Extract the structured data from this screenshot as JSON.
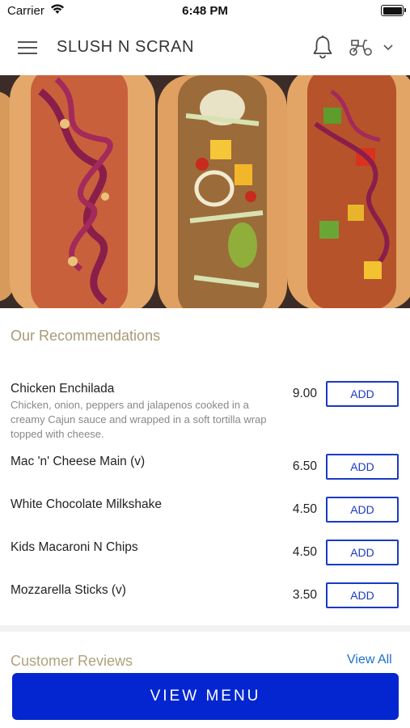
{
  "status_bar": {
    "carrier": "Carrier",
    "time": "6:48 PM"
  },
  "header": {
    "title": "SLUSH N SCRAN"
  },
  "icons": {
    "menu": "hamburger-menu-icon",
    "bell": "bell-icon",
    "delivery": "scooter-icon",
    "chevron": "chevron-down-icon"
  },
  "recommendations": {
    "title": "Our Recommendations",
    "items": [
      {
        "name": "Chicken Enchilada",
        "description": "Chicken, onion, peppers and jalapenos cooked in a creamy Cajun sauce and wrapped in a soft tortilla wrap topped with cheese.",
        "price": "9.00",
        "add_label": "ADD"
      },
      {
        "name": "Mac 'n' Cheese Main (v)",
        "description": "",
        "price": "6.50",
        "add_label": "ADD"
      },
      {
        "name": "White Chocolate Milkshake",
        "description": "",
        "price": "4.50",
        "add_label": "ADD"
      },
      {
        "name": "Kids Macaroni N Chips",
        "description": "",
        "price": "4.50",
        "add_label": "ADD"
      },
      {
        "name": "Mozzarella Sticks (v)",
        "description": "",
        "price": "3.50",
        "add_label": "ADD"
      }
    ]
  },
  "reviews": {
    "title": "Customer Reviews",
    "view_all": "View All"
  },
  "footer": {
    "view_menu": "VIEW MENU"
  },
  "colors": {
    "accent": "#0426d0",
    "add_border": "#1a3ac2",
    "section_title": "#a89a74",
    "link": "#1d72c8"
  }
}
